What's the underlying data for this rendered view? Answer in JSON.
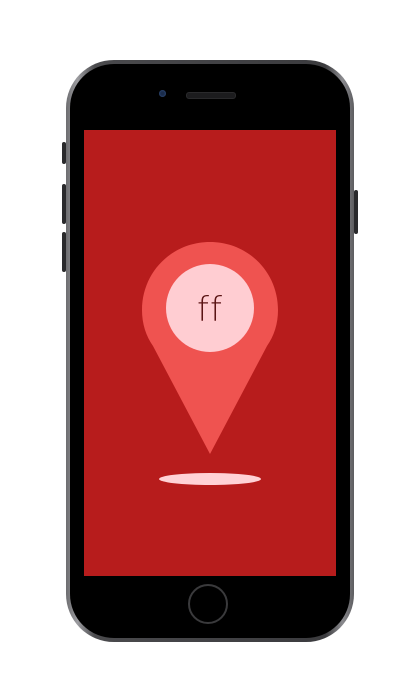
{
  "app": {
    "pin_label": "ff"
  },
  "colors": {
    "screen_background": "#b71c1c",
    "pin_fill": "#ef5350",
    "pin_inner_circle": "#ffcdd2",
    "pin_shadow": "#ffd2d6",
    "phone_body": "#000000"
  },
  "icons": {
    "pin": "map-pin-icon",
    "home": "home-button"
  }
}
